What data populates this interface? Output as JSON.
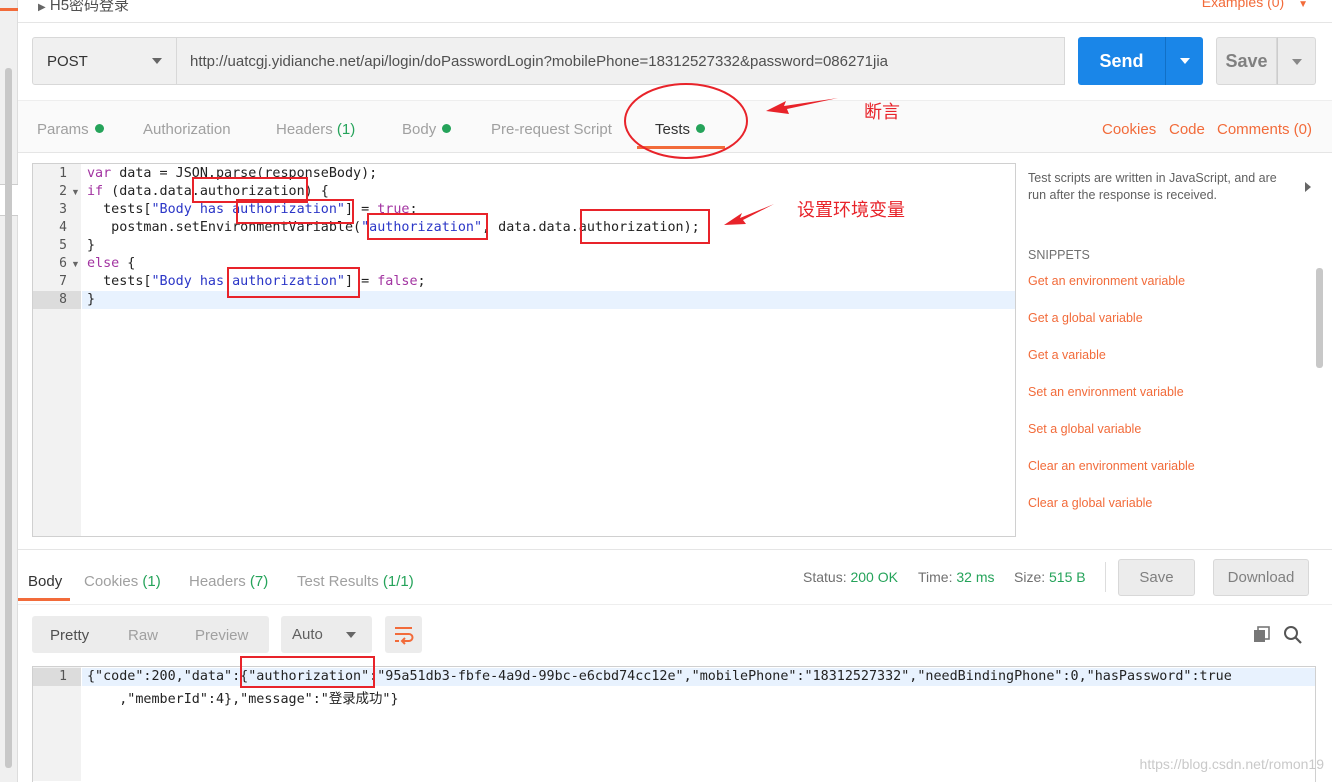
{
  "request": {
    "name": "H5密码登录",
    "examples_label": "Examples (0)",
    "method": "POST",
    "url": "http://uatcgj.yidianche.net/api/login/doPasswordLogin?mobilePhone=18312527332&password=086271jia",
    "send_label": "Send",
    "save_label": "Save"
  },
  "request_tabs": {
    "params": "Params",
    "authorization": "Authorization",
    "headers": "Headers",
    "headers_count": "(1)",
    "body": "Body",
    "prerequest": "Pre-request Script",
    "tests": "Tests",
    "cookies": "Cookies",
    "code": "Code",
    "comments": "Comments (0)"
  },
  "editor": {
    "line_numbers": [
      "1",
      "2",
      "3",
      "4",
      "5",
      "6",
      "7",
      "8"
    ],
    "lines": [
      [
        {
          "t": "var",
          "c": "kw"
        },
        {
          "t": " data = JSON.parse(responseBody);",
          "c": ""
        }
      ],
      [
        {
          "t": "if",
          "c": "kw"
        },
        {
          "t": " (data.data.authorization) {",
          "c": ""
        }
      ],
      [
        {
          "t": "  tests[",
          "c": ""
        },
        {
          "t": "\"Body has authorization\"",
          "c": "str"
        },
        {
          "t": "] = ",
          "c": ""
        },
        {
          "t": "true",
          "c": "kw"
        },
        {
          "t": ";",
          "c": ""
        }
      ],
      [
        {
          "t": "   postman.setEnvironmentVariable(",
          "c": ""
        },
        {
          "t": "\"authorization\"",
          "c": "str"
        },
        {
          "t": ", data.data.authorization);",
          "c": ""
        }
      ],
      [
        {
          "t": "}",
          "c": ""
        }
      ],
      [
        {
          "t": "else",
          "c": "kw"
        },
        {
          "t": " {",
          "c": ""
        }
      ],
      [
        {
          "t": "  tests[",
          "c": ""
        },
        {
          "t": "\"Body has authorization\"",
          "c": "str"
        },
        {
          "t": "] = ",
          "c": ""
        },
        {
          "t": "false",
          "c": "kw"
        },
        {
          "t": ";",
          "c": ""
        }
      ],
      [
        {
          "t": "}",
          "c": ""
        }
      ]
    ]
  },
  "snippets": {
    "description": "Test scripts are written in JavaScript, and are run after the response is received.",
    "title": "SNIPPETS",
    "items": [
      "Get an environment variable",
      "Get a global variable",
      "Get a variable",
      "Set an environment variable",
      "Set a global variable",
      "Clear an environment variable",
      "Clear a global variable"
    ]
  },
  "response": {
    "tabs": {
      "body": "Body",
      "cookies": "Cookies",
      "cookies_count": "(1)",
      "headers": "Headers",
      "headers_count": "(7)",
      "test_results": "Test Results",
      "test_results_count": "(1/1)"
    },
    "status_label": "Status:",
    "status_value": "200 OK",
    "time_label": "Time:",
    "time_value": "32 ms",
    "size_label": "Size:",
    "size_value": "515 B",
    "save_label": "Save",
    "download_label": "Download",
    "view_modes": [
      "Pretty",
      "Raw",
      "Preview"
    ],
    "format": "Auto",
    "line_number": "1",
    "body_line1": "{\"code\":200,\"data\":{\"authorization\":\"95a51db3-fbfe-4a9d-99bc-e6cbd74cc12e\",\"mobilePhone\":\"18312527332\",\"needBindingPhone\":0,\"hasPassword\":true",
    "body_line2": "    ,\"memberId\":4},\"message\":\"登录成功\"}"
  },
  "annotations": {
    "assert_label": "断言",
    "set_env_label": "设置环境变量",
    "color": "#e8232a"
  },
  "watermark": "https://blog.csdn.net/romon19",
  "colors": {
    "accent": "#f26b3a",
    "send": "#1a86e8",
    "status_green": "#25a35a"
  }
}
